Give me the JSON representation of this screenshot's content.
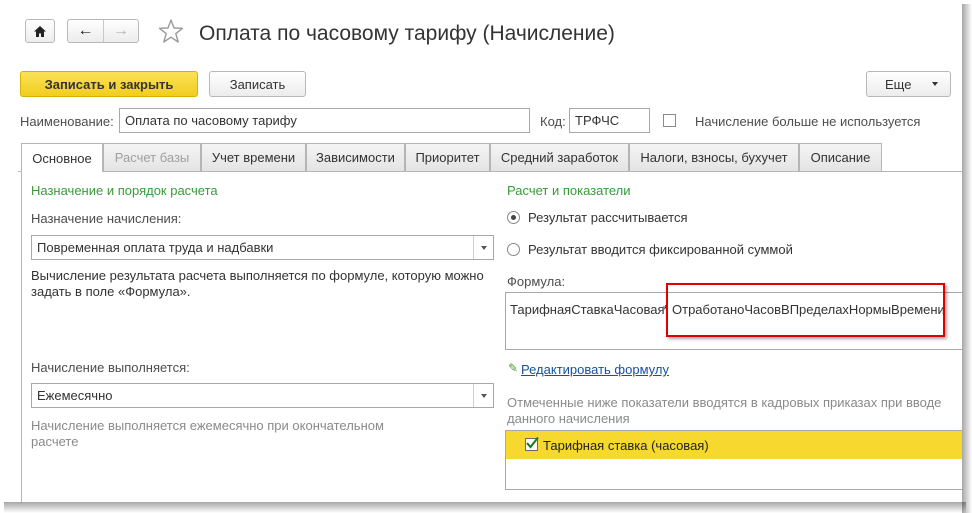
{
  "window": {
    "title": "Оплата по часовому тарифу (Начисление)"
  },
  "toolbar": {
    "save_close": "Записать и закрыть",
    "save": "Записать",
    "more": "Еще"
  },
  "header": {
    "name_label": "Наименование:",
    "name_value": "Оплата по часовому тарифу",
    "code_label": "Код:",
    "code_value": "ТРФЧС",
    "unused_label": "Начисление больше не используется"
  },
  "tabs": [
    {
      "label": "Основное"
    },
    {
      "label": "Расчет базы"
    },
    {
      "label": "Учет времени"
    },
    {
      "label": "Зависимости"
    },
    {
      "label": "Приоритет"
    },
    {
      "label": "Средний заработок"
    },
    {
      "label": "Налоги, взносы, бухучет"
    },
    {
      "label": "Описание"
    }
  ],
  "left": {
    "section_title": "Назначение и порядок расчета",
    "purpose_label": "Назначение начисления:",
    "purpose_value": "Повременная оплата труда и надбавки",
    "formula_note": "Вычисление результата расчета выполняется по формуле, которую можно задать в поле «Формула».",
    "period_label": "Начисление выполняется:",
    "period_value": "Ежемесячно",
    "period_hint": "Начисление выполняется ежемесячно при окончательном расчете"
  },
  "right": {
    "section_title": "Расчет и показатели",
    "radio_calc": "Результат рассчитывается",
    "radio_fixed": "Результат вводится фиксированной суммой",
    "formula_label": "Формула:",
    "formula_part1": "ТарифнаяСтавкаЧасовая",
    "formula_op": "*",
    "formula_part2": "ОтработаноЧасовВПределахНормыВремени",
    "edit_formula": "Редактировать формулу",
    "indicators_note": "Отмеченные ниже показатели вводятся в кадровых приказах при вводе данного начисления",
    "indicator_item": "Тарифная ставка (часовая)"
  },
  "colors": {
    "accent_yellow": "#f7d82e",
    "section_green": "#3a9a3a",
    "highlight_red": "#e00000",
    "link_blue": "#1a4f9a"
  }
}
